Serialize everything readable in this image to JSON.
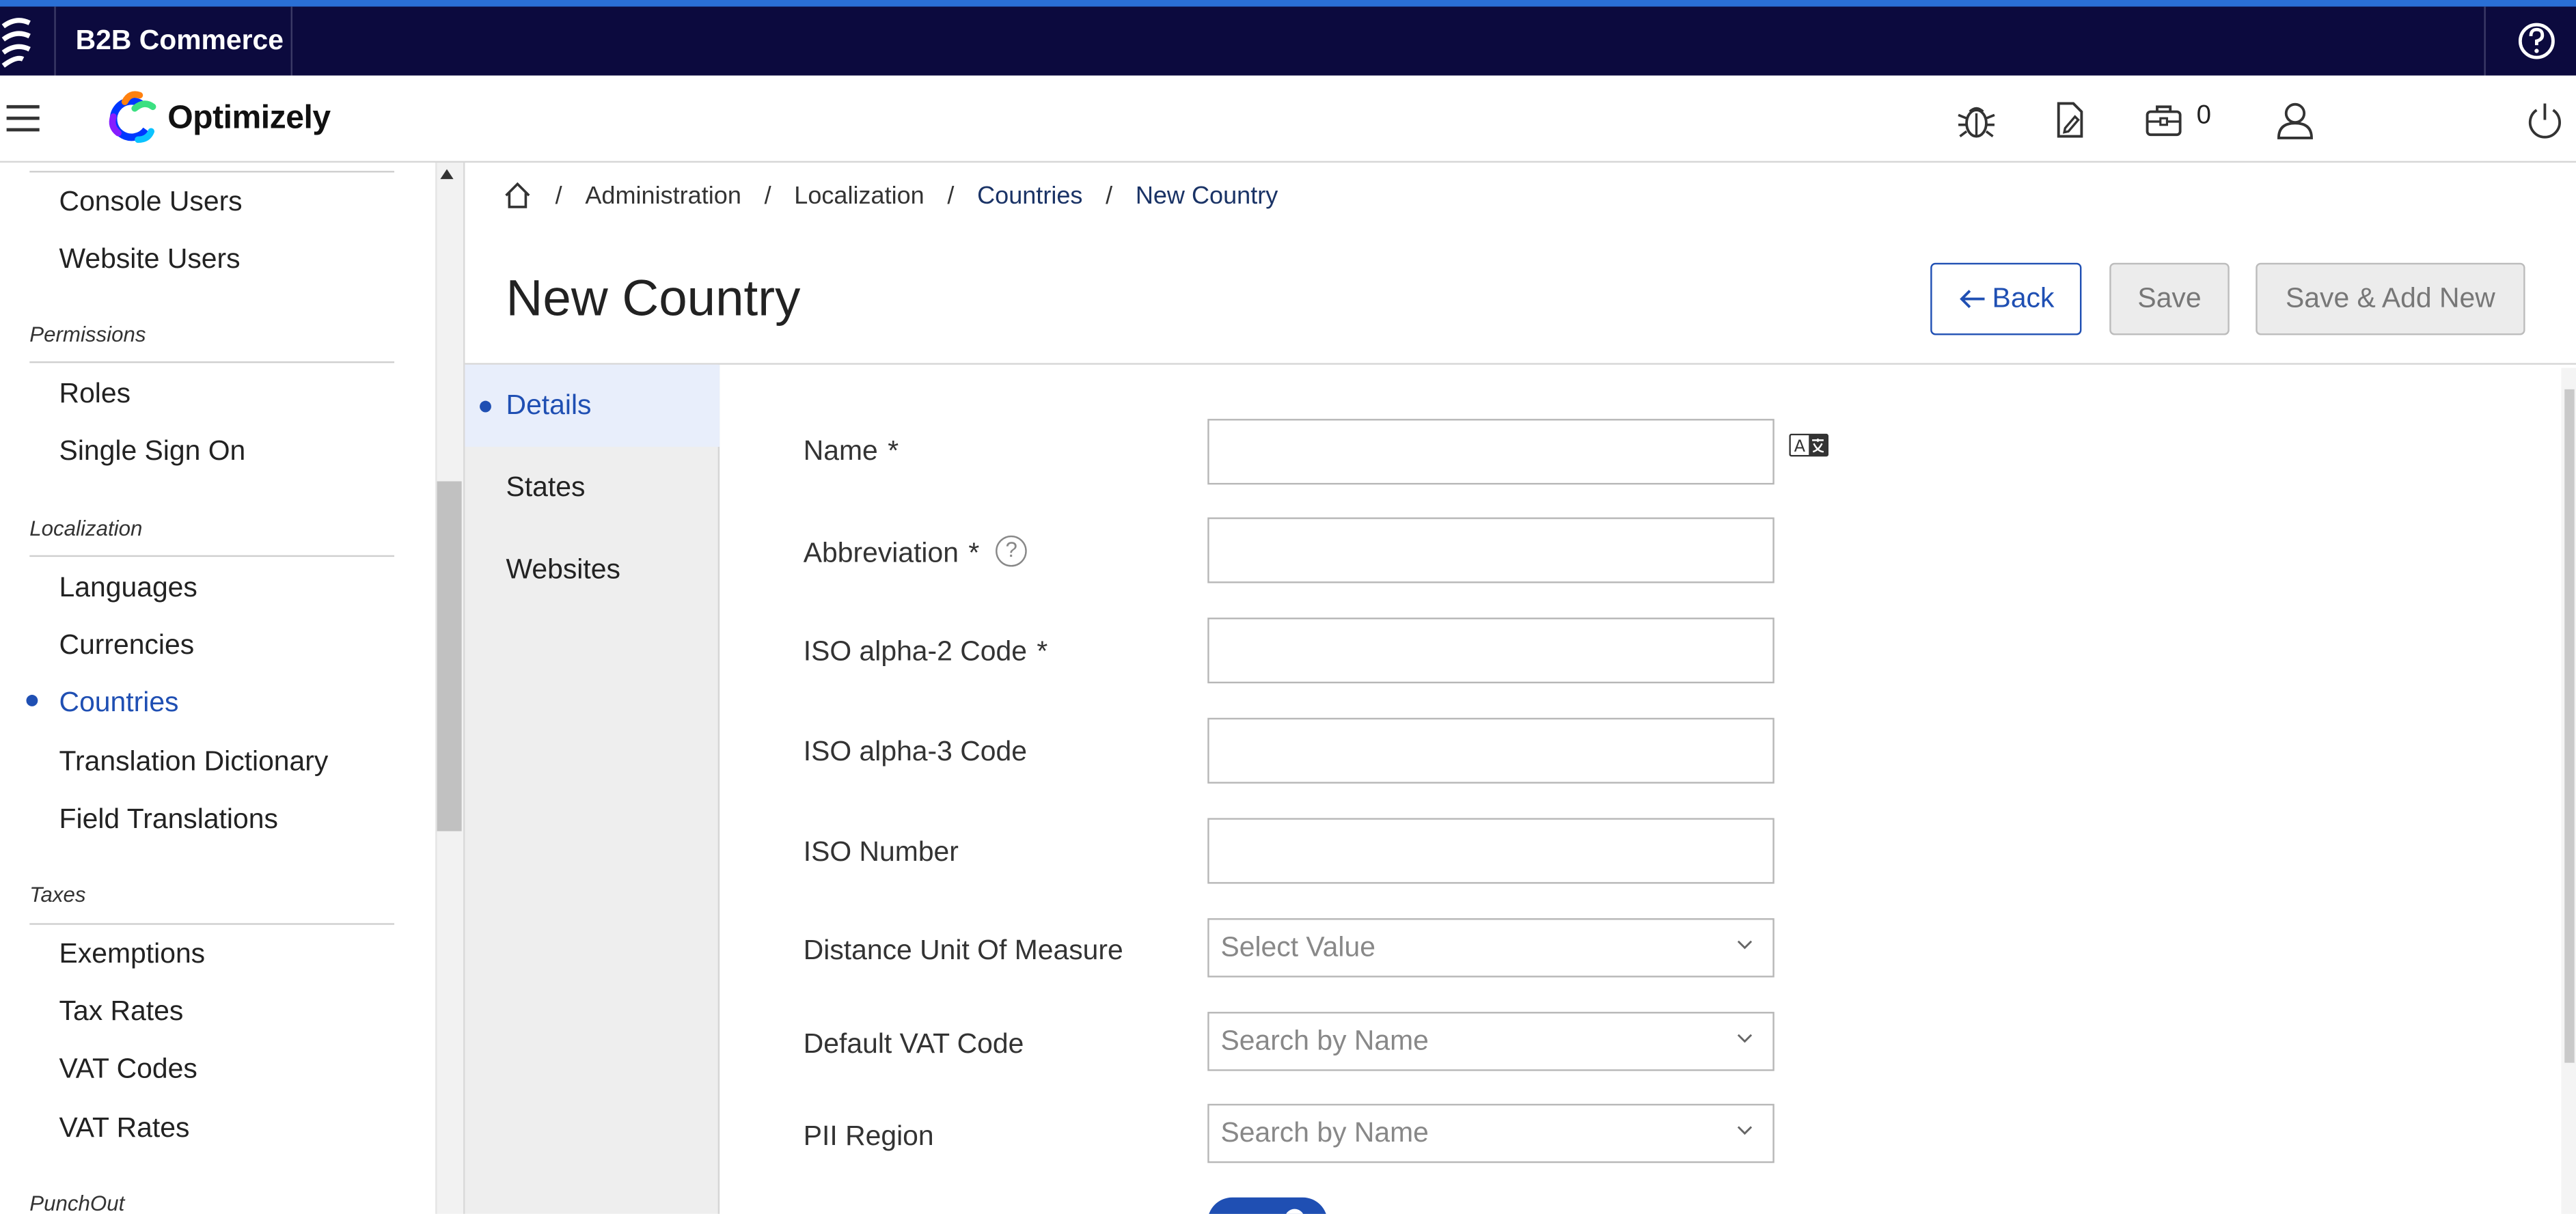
{
  "app": {
    "name": "B2B Commerce",
    "brand": "Optimizely"
  },
  "header": {
    "cart_count": "0"
  },
  "sidebar": {
    "items_top": [
      {
        "label": "Console Users"
      },
      {
        "label": "Website Users"
      }
    ],
    "sections": [
      {
        "title": "Permissions",
        "items": [
          {
            "label": "Roles"
          },
          {
            "label": "Single Sign On"
          }
        ]
      },
      {
        "title": "Localization",
        "items": [
          {
            "label": "Languages"
          },
          {
            "label": "Currencies"
          },
          {
            "label": "Countries",
            "active": true
          },
          {
            "label": "Translation Dictionary"
          },
          {
            "label": "Field Translations"
          }
        ]
      },
      {
        "title": "Taxes",
        "items": [
          {
            "label": "Exemptions"
          },
          {
            "label": "Tax Rates"
          },
          {
            "label": "VAT Codes"
          },
          {
            "label": "VAT Rates"
          }
        ]
      },
      {
        "title": "PunchOut",
        "items": []
      }
    ]
  },
  "breadcrumb": {
    "items": [
      {
        "label": "Administration"
      },
      {
        "label": "Localization"
      },
      {
        "label": "Countries"
      },
      {
        "label": "New Country"
      }
    ],
    "separator": "/"
  },
  "page": {
    "title": "New Country",
    "back_label": "Back",
    "save_label": "Save",
    "save_add_label": "Save & Add New"
  },
  "tabs": [
    {
      "label": "Details",
      "active": true
    },
    {
      "label": "States"
    },
    {
      "label": "Websites"
    }
  ],
  "form": {
    "required_marker": "*",
    "help_glyph": "?",
    "name_label": "Name",
    "name_value": "",
    "abbreviation_label": "Abbreviation",
    "abbreviation_value": "",
    "iso2_label": "ISO alpha-2 Code",
    "iso2_value": "",
    "iso3_label": "ISO alpha-3 Code",
    "iso3_value": "",
    "iso_number_label": "ISO Number",
    "iso_number_value": "",
    "distance_uom_label": "Distance Unit Of Measure",
    "distance_uom_placeholder": "Select Value",
    "default_vat_label": "Default VAT Code",
    "default_vat_placeholder": "Search by Name",
    "pii_region_label": "PII Region",
    "pii_region_placeholder": "Search by Name"
  },
  "colors": {
    "topbar": "#0c0a3e",
    "accent": "#1f4fb3",
    "topbar_border": "#2a6fd6"
  },
  "icons": [
    "optimizely-logo-icon",
    "help-icon",
    "menu-icon",
    "bug-icon",
    "edit-document-icon",
    "briefcase-icon",
    "user-icon",
    "power-icon",
    "home-icon",
    "translate-icon",
    "help-circle-icon",
    "chevron-down-icon",
    "arrow-left-icon"
  ]
}
